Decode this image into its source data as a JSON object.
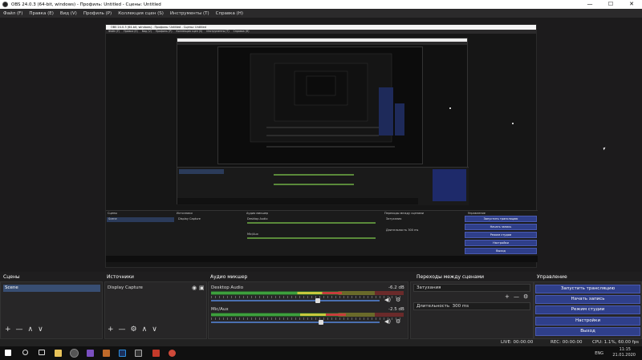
{
  "window": {
    "title": "OBS 24.0.3 (64-bit, windows) - Профиль: Untitled - Сцены: Untitled",
    "min": "—",
    "max": "☐",
    "close": "✕"
  },
  "menu": [
    "Файл (F)",
    "Правка (E)",
    "Вид (V)",
    "Профиль (P)",
    "Коллекция сцен (S)",
    "Инструменты (T)",
    "Справка (H)"
  ],
  "nested_title": "OBS 24.0.3 (64-bit, windows) - Профиль: Untitled - Сцены: Untitled",
  "nested_menu": [
    "Файл (F)",
    "Правка (E)",
    "Вид (V)",
    "Профиль (P)",
    "Коллекция сцен (S)",
    "Инструменты (T)",
    "Справка (H)"
  ],
  "panels": {
    "scenes": "Сцены",
    "sources": "Источники",
    "mixer": "Аудио микшер",
    "transitions": "Переходы между сценами",
    "controls": "Управление"
  },
  "scenes": [
    "Scene"
  ],
  "sources": [
    "Display Capture"
  ],
  "mixer": [
    {
      "name": "Desktop Audio",
      "db": "-6.2 dB",
      "level": 0.68,
      "volume": 0.62
    },
    {
      "name": "Mic/Aux",
      "db": "-2.5 dB",
      "level": 0.7,
      "volume": 0.64
    }
  ],
  "transitions": {
    "type": "Затухания",
    "duration_label": "Длительность",
    "duration": "300 ms"
  },
  "controls": [
    "Запустить трансляцию",
    "Начать запись",
    "Режим студии",
    "Настройки",
    "Выход"
  ],
  "status": {
    "live": "LIVE: 00:00:00",
    "rec": "REC: 00:00:00",
    "cpu": "CPU: 1.1%, 60.00 fps"
  },
  "tray": {
    "lang": "ENG",
    "time": "11:15",
    "date": "21.01.2020"
  },
  "colors": {
    "accent": "#2f3f8a",
    "selection": "#384e73",
    "bg": "#1f1e1f"
  }
}
